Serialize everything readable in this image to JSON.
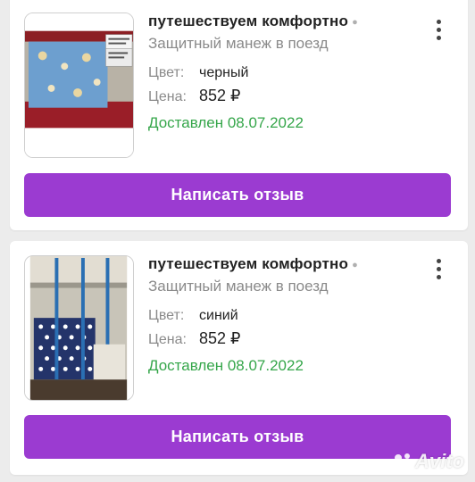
{
  "orders": [
    {
      "seller": "путешествуем комфортно",
      "product": "Защитный манеж в поезд",
      "color_label": "Цвет:",
      "color_value": "черный",
      "price_label": "Цена:",
      "price_value": "852 ₽",
      "delivered": "Доставлен 08.07.2022",
      "review_button": "Написать отзыв",
      "image": "train-bunk-barrier-blue-pattern"
    },
    {
      "seller": "путешествуем комфортно",
      "product": "Защитный манеж в поезд",
      "color_label": "Цвет:",
      "color_value": "синий",
      "price_label": "Цена:",
      "price_value": "852 ₽",
      "delivered": "Доставлен 08.07.2022",
      "review_button": "Написать отзыв",
      "image": "train-bunk-barrier-navy-polka-dot"
    }
  ],
  "icons": {
    "more": "more-vertical-icon",
    "separator": "dot-icon"
  },
  "colors": {
    "accent_button": "#9b3bd1",
    "delivered_text": "#35a64a",
    "muted_text": "#8a8a8a",
    "background": "#ececec"
  },
  "watermark": {
    "text": "Avito"
  }
}
